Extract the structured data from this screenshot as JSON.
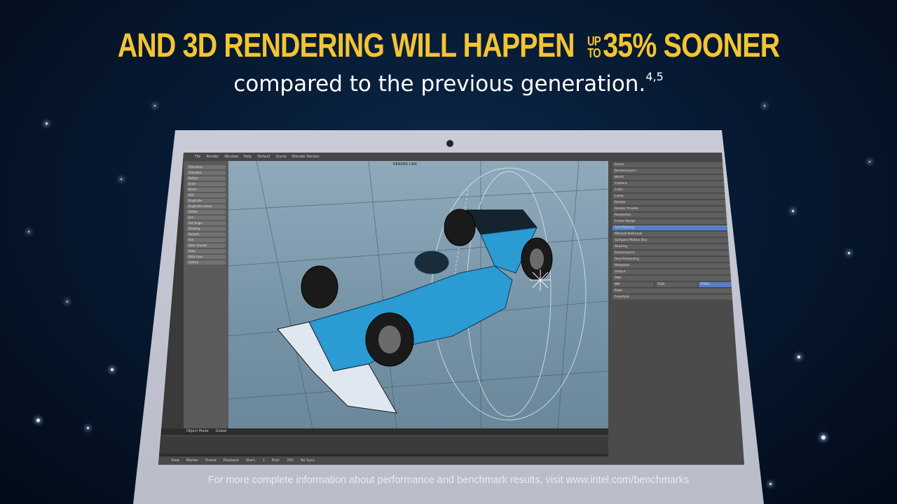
{
  "headline": {
    "main": "AND 3D RENDERING WILL HAPPEN",
    "upto_top": "UP",
    "upto_bottom": "TO",
    "highlight": "35% SOONER"
  },
  "subhead": {
    "text": "compared to the previous generation.",
    "footnote": "4,5"
  },
  "footer": {
    "text": "For more complete information about performance and benchmark results, visit www.intel.com/benchmarks"
  },
  "screen": {
    "viewport_label": "RENDER CAM",
    "topbar": [
      "File",
      "Render",
      "Window",
      "Help",
      "Default",
      "Scene",
      "Blender Render"
    ],
    "left_tools": [
      "Transform",
      "Translate",
      "Rotate",
      "Scale",
      "Mirror",
      "Edit",
      "Duplicate",
      "Duplicate Linked",
      "Delete",
      "Join",
      "Set Origin",
      "Shading",
      "Smooth",
      "Flat",
      "Data Transfer",
      "Data",
      "Data Layo",
      "History"
    ],
    "right_panel": [
      "Scene",
      "RenderLayers",
      "World",
      "Camera",
      "Cube",
      "Lamp",
      "Render",
      "Render Presets",
      "Resolution",
      "Frame Range",
      "Anti-Aliasing",
      "Mitchell-Netravali",
      "Sampled Motion Blur",
      "Shading",
      "Performance",
      "Post Processing",
      "Metadata",
      "Output",
      "PNG",
      "BW",
      "RGB",
      "RGBA",
      "Bake",
      "Freestyle"
    ],
    "timeline_menu": [
      "View",
      "Marker",
      "Frame",
      "Playback",
      "Start:",
      "1",
      "End:",
      "250",
      "No Sync"
    ],
    "mode": "Object Mode",
    "orientation": "Global"
  },
  "colors": {
    "headline": "#f3c433",
    "car_body": "#2a9bd3",
    "background": "#071a33"
  }
}
